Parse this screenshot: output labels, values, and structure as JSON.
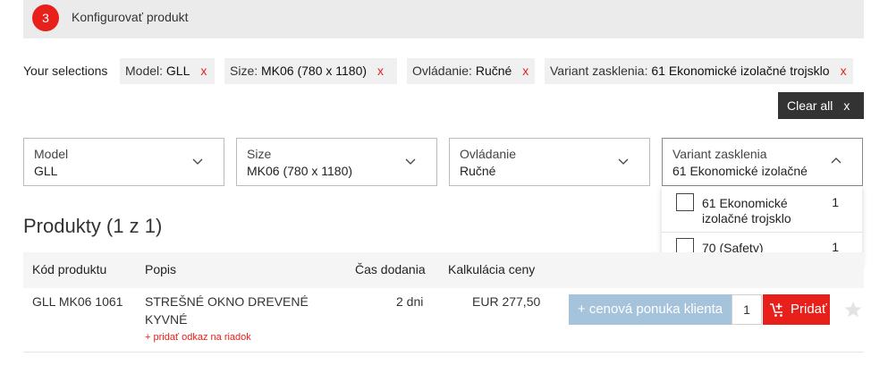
{
  "step": {
    "number": "3",
    "title": "Konfigurovať produkt"
  },
  "selections": {
    "label": "Your selections",
    "remove_glyph": "x",
    "chips": [
      {
        "key": "Model: ",
        "value": "GLL"
      },
      {
        "key": "Size: ",
        "value": "MK06 (780 x 1180)"
      },
      {
        "key": "Ovládanie: ",
        "value": "Ručné"
      },
      {
        "key": "Variant zasklenia: ",
        "value": "61 Ekonomické izolačné trojsklo"
      }
    ],
    "clear_all": "Clear all",
    "clear_all_x": "x"
  },
  "filters": [
    {
      "label": "Model",
      "value": "GLL",
      "icon": "chevron-down-icon"
    },
    {
      "label": "Size",
      "value": "MK06 (780 x 1180)",
      "icon": "chevron-down-icon"
    },
    {
      "label": "Ovládanie",
      "value": "Ručné",
      "icon": "chevron-down-icon"
    },
    {
      "label": "Variant zasklenia",
      "value": "61 Ekonomické izolačné",
      "icon": "chevron-up-icon"
    }
  ],
  "dropdown_options": [
    {
      "label": "61 Ekonomické izolačné trojsklo",
      "count": "1",
      "checked": false
    },
    {
      "label": "70 (Safety)",
      "count": "1",
      "checked": false
    }
  ],
  "products": {
    "title": "Produkty (1 z 1)",
    "columns": [
      "Kód produktu",
      "Popis",
      "Čas dodania",
      "Kalkulácia ceny"
    ],
    "rows": [
      {
        "code": "GLL MK06 1061",
        "description": "STREŠNÉ OKNO DREVENÉ KYVNÉ",
        "link": "+ pridať odkaz na riadok",
        "delivery": "2 dni",
        "price": "EUR 277,50",
        "quote_button": "+ cenová ponuka klienta",
        "quantity": "1",
        "add_button": "Pridať"
      }
    ]
  },
  "colors": {
    "accent": "#e8201c",
    "quote": "#a6c3dc",
    "dark": "#333333"
  }
}
